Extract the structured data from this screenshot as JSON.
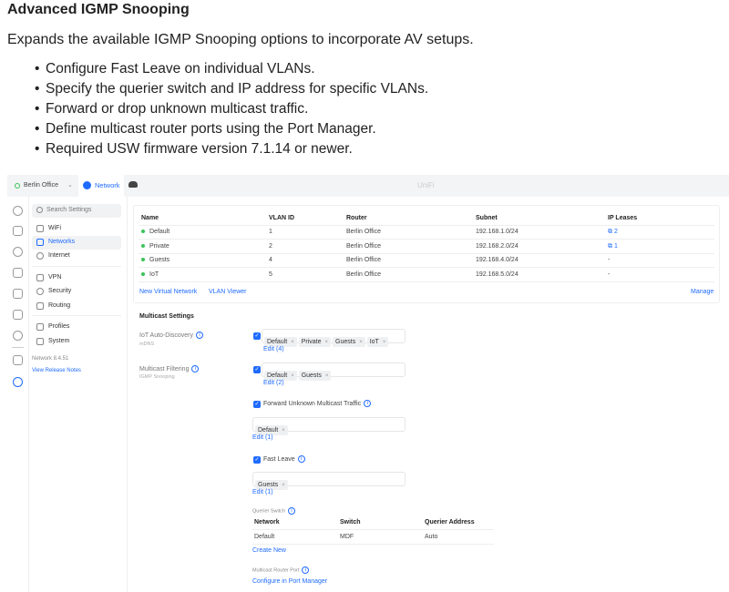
{
  "doc": {
    "title": "Advanced IGMP Snooping",
    "description": "Expands the available IGMP Snooping options to incorporate AV setups.",
    "bullets": [
      "Configure Fast Leave on individual VLANs.",
      "Specify the querier switch and IP address for specific VLANs.",
      "Forward or drop unknown multicast traffic.",
      "Define multicast router ports using the Port Manager.",
      "Required USW firmware version 7.1.14 or newer."
    ]
  },
  "topbar": {
    "site": "Berlin Office",
    "tab": "Network",
    "brand": "UniFi"
  },
  "sidebar": {
    "search_placeholder": "Search Settings",
    "items": [
      "WiFi",
      "Networks",
      "Internet",
      "VPN",
      "Security",
      "Routing",
      "Profiles",
      "System"
    ],
    "version": "Network 8.4.51",
    "release_notes": "View Release Notes"
  },
  "networks": {
    "headers": [
      "Name",
      "VLAN ID",
      "Router",
      "Subnet",
      "IP Leases"
    ],
    "rows": [
      [
        "Default",
        "1",
        "Berlin Office",
        "192.168.1.0/24",
        "2"
      ],
      [
        "Private",
        "2",
        "Berlin Office",
        "192.168.2.0/24",
        "1"
      ],
      [
        "Guests",
        "4",
        "Berlin Office",
        "192.168.4.0/24",
        "-"
      ],
      [
        "IoT",
        "5",
        "Berlin Office",
        "192.168.5.0/24",
        "-"
      ]
    ],
    "new_virtual": "New Virtual Network",
    "vlan_viewer": "VLAN Viewer",
    "manage": "Manage"
  },
  "multicast": {
    "title": "Multicast Settings",
    "iot_label": "IoT Auto-Discovery",
    "iot_sub": "mDNS",
    "iot_tags": [
      "Default",
      "Private",
      "Guests",
      "IoT"
    ],
    "iot_edit": "Edit (4)",
    "filter_label": "Multicast Filtering",
    "filter_sub": "IGMP Snooping",
    "filter_tags": [
      "Default",
      "Guests"
    ],
    "filter_edit": "Edit (2)",
    "forward_label": "Forward Unknown Multicast Traffic",
    "forward_tags": [
      "Default"
    ],
    "forward_edit": "Edit (1)",
    "fast_label": "Fast Leave",
    "fast_tags": [
      "Guests"
    ],
    "fast_edit": "Edit (1)",
    "querier_label": "Querier Switch",
    "querier_headers": [
      "Network",
      "Switch",
      "Querier Address"
    ],
    "querier_row": [
      "Default",
      "MDF",
      "Auto"
    ],
    "create_new": "Create New",
    "router_port_label": "Multicast Router Port",
    "configure": "Configure in Port Manager"
  }
}
